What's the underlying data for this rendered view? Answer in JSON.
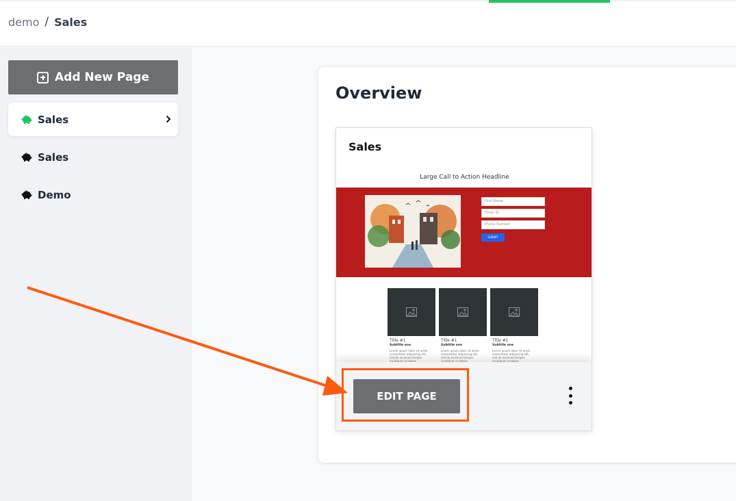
{
  "breadcrumb": {
    "root": "demo",
    "separator": "/",
    "current": "Sales"
  },
  "sidebar": {
    "add_button_label": "Add New Page",
    "items": [
      {
        "label": "Sales",
        "active": true,
        "icon": "piggy-bank-icon",
        "icon_color": "#22c55e"
      },
      {
        "label": "Sales",
        "active": false,
        "icon": "piggy-bank-icon",
        "icon_color": "#111111"
      },
      {
        "label": "Demo",
        "active": false,
        "icon": "piggy-bank-icon",
        "icon_color": "#111111"
      }
    ]
  },
  "main": {
    "title": "Overview",
    "page_card": {
      "title": "Sales",
      "preview": {
        "headline": "Large Call to Action Headline",
        "form": {
          "first_name_placeholder": "First Name",
          "email_placeholder": "Email ID",
          "phone_placeholder": "Phone Number",
          "submit_label": "SUBMIT"
        },
        "tiles": [
          {
            "title": "Title #1",
            "subtitle": "Subtitle one",
            "body": "Lorem ipsum dolor sit amet, consectetur adipiscing elit, sed do eiusmod tempor incididunt ut labore"
          },
          {
            "title": "Title #1",
            "subtitle": "Subtitle one",
            "body": "Lorem ipsum dolor sit amet, consectetur adipiscing elit, sed do eiusmod tempor incididunt ut labore"
          },
          {
            "title": "Title #1",
            "subtitle": "Subtitle one",
            "body": "Lorem ipsum dolor sit amet, consectetur adipiscing elit, sed do eiusmod tempor incididunt ut labore"
          }
        ]
      },
      "edit_button_label": "EDIT PAGE"
    }
  },
  "colors": {
    "accent_green": "#22c55e",
    "button_gray": "#6c6f71",
    "hero_red": "#b91c1c",
    "annotation_orange": "#fe5a10"
  }
}
